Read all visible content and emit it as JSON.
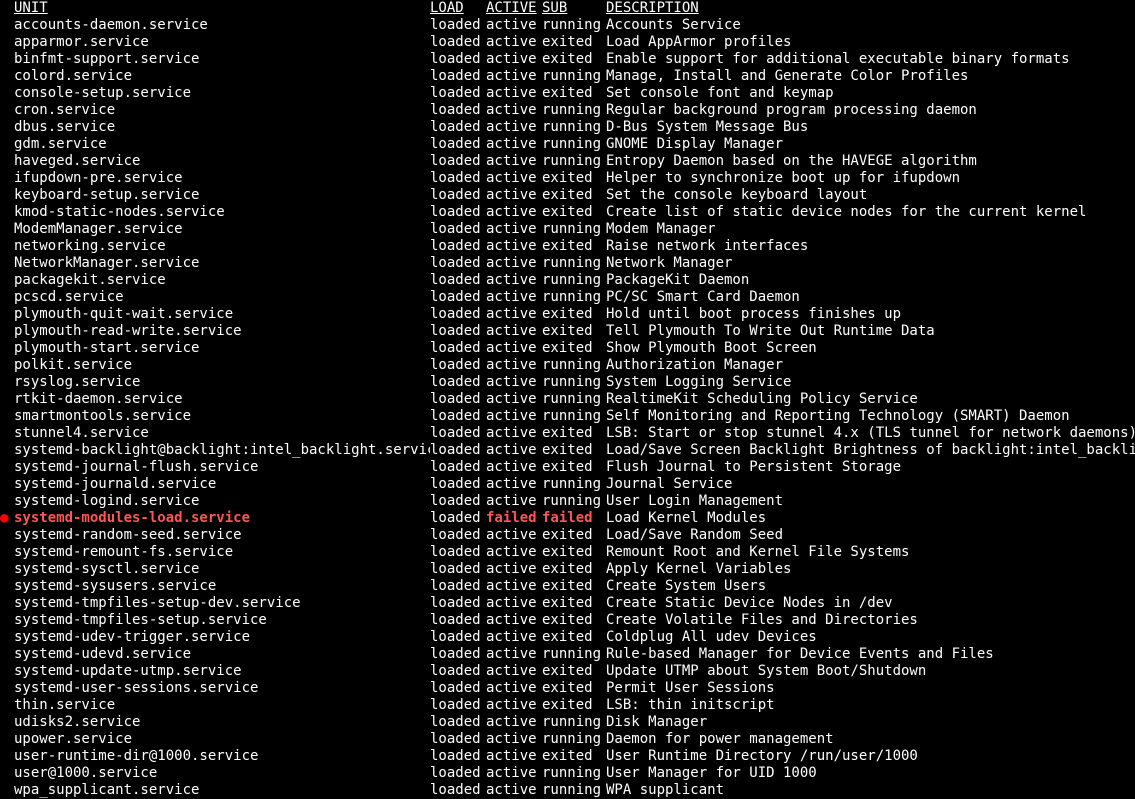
{
  "headers": {
    "unit": "UNIT",
    "load": "LOAD",
    "active": "ACTIVE",
    "sub": "SUB",
    "description": "DESCRIPTION"
  },
  "services": [
    {
      "unit": "accounts-daemon.service",
      "load": "loaded",
      "active": "active",
      "sub": "running",
      "description": "Accounts Service",
      "failed": false
    },
    {
      "unit": "apparmor.service",
      "load": "loaded",
      "active": "active",
      "sub": "exited",
      "description": "Load AppArmor profiles",
      "failed": false
    },
    {
      "unit": "binfmt-support.service",
      "load": "loaded",
      "active": "active",
      "sub": "exited",
      "description": "Enable support for additional executable binary formats",
      "failed": false
    },
    {
      "unit": "colord.service",
      "load": "loaded",
      "active": "active",
      "sub": "running",
      "description": "Manage, Install and Generate Color Profiles",
      "failed": false
    },
    {
      "unit": "console-setup.service",
      "load": "loaded",
      "active": "active",
      "sub": "exited",
      "description": "Set console font and keymap",
      "failed": false
    },
    {
      "unit": "cron.service",
      "load": "loaded",
      "active": "active",
      "sub": "running",
      "description": "Regular background program processing daemon",
      "failed": false
    },
    {
      "unit": "dbus.service",
      "load": "loaded",
      "active": "active",
      "sub": "running",
      "description": "D-Bus System Message Bus",
      "failed": false
    },
    {
      "unit": "gdm.service",
      "load": "loaded",
      "active": "active",
      "sub": "running",
      "description": "GNOME Display Manager",
      "failed": false
    },
    {
      "unit": "haveged.service",
      "load": "loaded",
      "active": "active",
      "sub": "running",
      "description": "Entropy Daemon based on the HAVEGE algorithm",
      "failed": false
    },
    {
      "unit": "ifupdown-pre.service",
      "load": "loaded",
      "active": "active",
      "sub": "exited",
      "description": "Helper to synchronize boot up for ifupdown",
      "failed": false
    },
    {
      "unit": "keyboard-setup.service",
      "load": "loaded",
      "active": "active",
      "sub": "exited",
      "description": "Set the console keyboard layout",
      "failed": false
    },
    {
      "unit": "kmod-static-nodes.service",
      "load": "loaded",
      "active": "active",
      "sub": "exited",
      "description": "Create list of static device nodes for the current kernel",
      "failed": false
    },
    {
      "unit": "ModemManager.service",
      "load": "loaded",
      "active": "active",
      "sub": "running",
      "description": "Modem Manager",
      "failed": false
    },
    {
      "unit": "networking.service",
      "load": "loaded",
      "active": "active",
      "sub": "exited",
      "description": "Raise network interfaces",
      "failed": false
    },
    {
      "unit": "NetworkManager.service",
      "load": "loaded",
      "active": "active",
      "sub": "running",
      "description": "Network Manager",
      "failed": false
    },
    {
      "unit": "packagekit.service",
      "load": "loaded",
      "active": "active",
      "sub": "running",
      "description": "PackageKit Daemon",
      "failed": false
    },
    {
      "unit": "pcscd.service",
      "load": "loaded",
      "active": "active",
      "sub": "running",
      "description": "PC/SC Smart Card Daemon",
      "failed": false
    },
    {
      "unit": "plymouth-quit-wait.service",
      "load": "loaded",
      "active": "active",
      "sub": "exited",
      "description": "Hold until boot process finishes up",
      "failed": false
    },
    {
      "unit": "plymouth-read-write.service",
      "load": "loaded",
      "active": "active",
      "sub": "exited",
      "description": "Tell Plymouth To Write Out Runtime Data",
      "failed": false
    },
    {
      "unit": "plymouth-start.service",
      "load": "loaded",
      "active": "active",
      "sub": "exited",
      "description": "Show Plymouth Boot Screen",
      "failed": false
    },
    {
      "unit": "polkit.service",
      "load": "loaded",
      "active": "active",
      "sub": "running",
      "description": "Authorization Manager",
      "failed": false
    },
    {
      "unit": "rsyslog.service",
      "load": "loaded",
      "active": "active",
      "sub": "running",
      "description": "System Logging Service",
      "failed": false
    },
    {
      "unit": "rtkit-daemon.service",
      "load": "loaded",
      "active": "active",
      "sub": "running",
      "description": "RealtimeKit Scheduling Policy Service",
      "failed": false
    },
    {
      "unit": "smartmontools.service",
      "load": "loaded",
      "active": "active",
      "sub": "running",
      "description": "Self Monitoring and Reporting Technology (SMART) Daemon",
      "failed": false
    },
    {
      "unit": "stunnel4.service",
      "load": "loaded",
      "active": "active",
      "sub": "exited",
      "description": "LSB: Start or stop stunnel 4.x (TLS tunnel for network daemons)",
      "failed": false
    },
    {
      "unit": "systemd-backlight@backlight:intel_backlight.service",
      "load": "loaded",
      "active": "active",
      "sub": "exited",
      "description": "Load/Save Screen Backlight Brightness of backlight:intel_backlight",
      "failed": false
    },
    {
      "unit": "systemd-journal-flush.service",
      "load": "loaded",
      "active": "active",
      "sub": "exited",
      "description": "Flush Journal to Persistent Storage",
      "failed": false
    },
    {
      "unit": "systemd-journald.service",
      "load": "loaded",
      "active": "active",
      "sub": "running",
      "description": "Journal Service",
      "failed": false
    },
    {
      "unit": "systemd-logind.service",
      "load": "loaded",
      "active": "active",
      "sub": "running",
      "description": "User Login Management",
      "failed": false
    },
    {
      "unit": "systemd-modules-load.service",
      "load": "loaded",
      "active": "failed",
      "sub": "failed",
      "description": "Load Kernel Modules",
      "failed": true
    },
    {
      "unit": "systemd-random-seed.service",
      "load": "loaded",
      "active": "active",
      "sub": "exited",
      "description": "Load/Save Random Seed",
      "failed": false
    },
    {
      "unit": "systemd-remount-fs.service",
      "load": "loaded",
      "active": "active",
      "sub": "exited",
      "description": "Remount Root and Kernel File Systems",
      "failed": false
    },
    {
      "unit": "systemd-sysctl.service",
      "load": "loaded",
      "active": "active",
      "sub": "exited",
      "description": "Apply Kernel Variables",
      "failed": false
    },
    {
      "unit": "systemd-sysusers.service",
      "load": "loaded",
      "active": "active",
      "sub": "exited",
      "description": "Create System Users",
      "failed": false
    },
    {
      "unit": "systemd-tmpfiles-setup-dev.service",
      "load": "loaded",
      "active": "active",
      "sub": "exited",
      "description": "Create Static Device Nodes in /dev",
      "failed": false
    },
    {
      "unit": "systemd-tmpfiles-setup.service",
      "load": "loaded",
      "active": "active",
      "sub": "exited",
      "description": "Create Volatile Files and Directories",
      "failed": false
    },
    {
      "unit": "systemd-udev-trigger.service",
      "load": "loaded",
      "active": "active",
      "sub": "exited",
      "description": "Coldplug All udev Devices",
      "failed": false
    },
    {
      "unit": "systemd-udevd.service",
      "load": "loaded",
      "active": "active",
      "sub": "running",
      "description": "Rule-based Manager for Device Events and Files",
      "failed": false
    },
    {
      "unit": "systemd-update-utmp.service",
      "load": "loaded",
      "active": "active",
      "sub": "exited",
      "description": "Update UTMP about System Boot/Shutdown",
      "failed": false
    },
    {
      "unit": "systemd-user-sessions.service",
      "load": "loaded",
      "active": "active",
      "sub": "exited",
      "description": "Permit User Sessions",
      "failed": false
    },
    {
      "unit": "thin.service",
      "load": "loaded",
      "active": "active",
      "sub": "exited",
      "description": "LSB: thin initscript",
      "failed": false
    },
    {
      "unit": "udisks2.service",
      "load": "loaded",
      "active": "active",
      "sub": "running",
      "description": "Disk Manager",
      "failed": false
    },
    {
      "unit": "upower.service",
      "load": "loaded",
      "active": "active",
      "sub": "running",
      "description": "Daemon for power management",
      "failed": false
    },
    {
      "unit": "user-runtime-dir@1000.service",
      "load": "loaded",
      "active": "active",
      "sub": "exited",
      "description": "User Runtime Directory /run/user/1000",
      "failed": false
    },
    {
      "unit": "user@1000.service",
      "load": "loaded",
      "active": "active",
      "sub": "running",
      "description": "User Manager for UID 1000",
      "failed": false
    },
    {
      "unit": "wpa_supplicant.service",
      "load": "loaded",
      "active": "active",
      "sub": "running",
      "description": "WPA supplicant",
      "failed": false
    }
  ]
}
